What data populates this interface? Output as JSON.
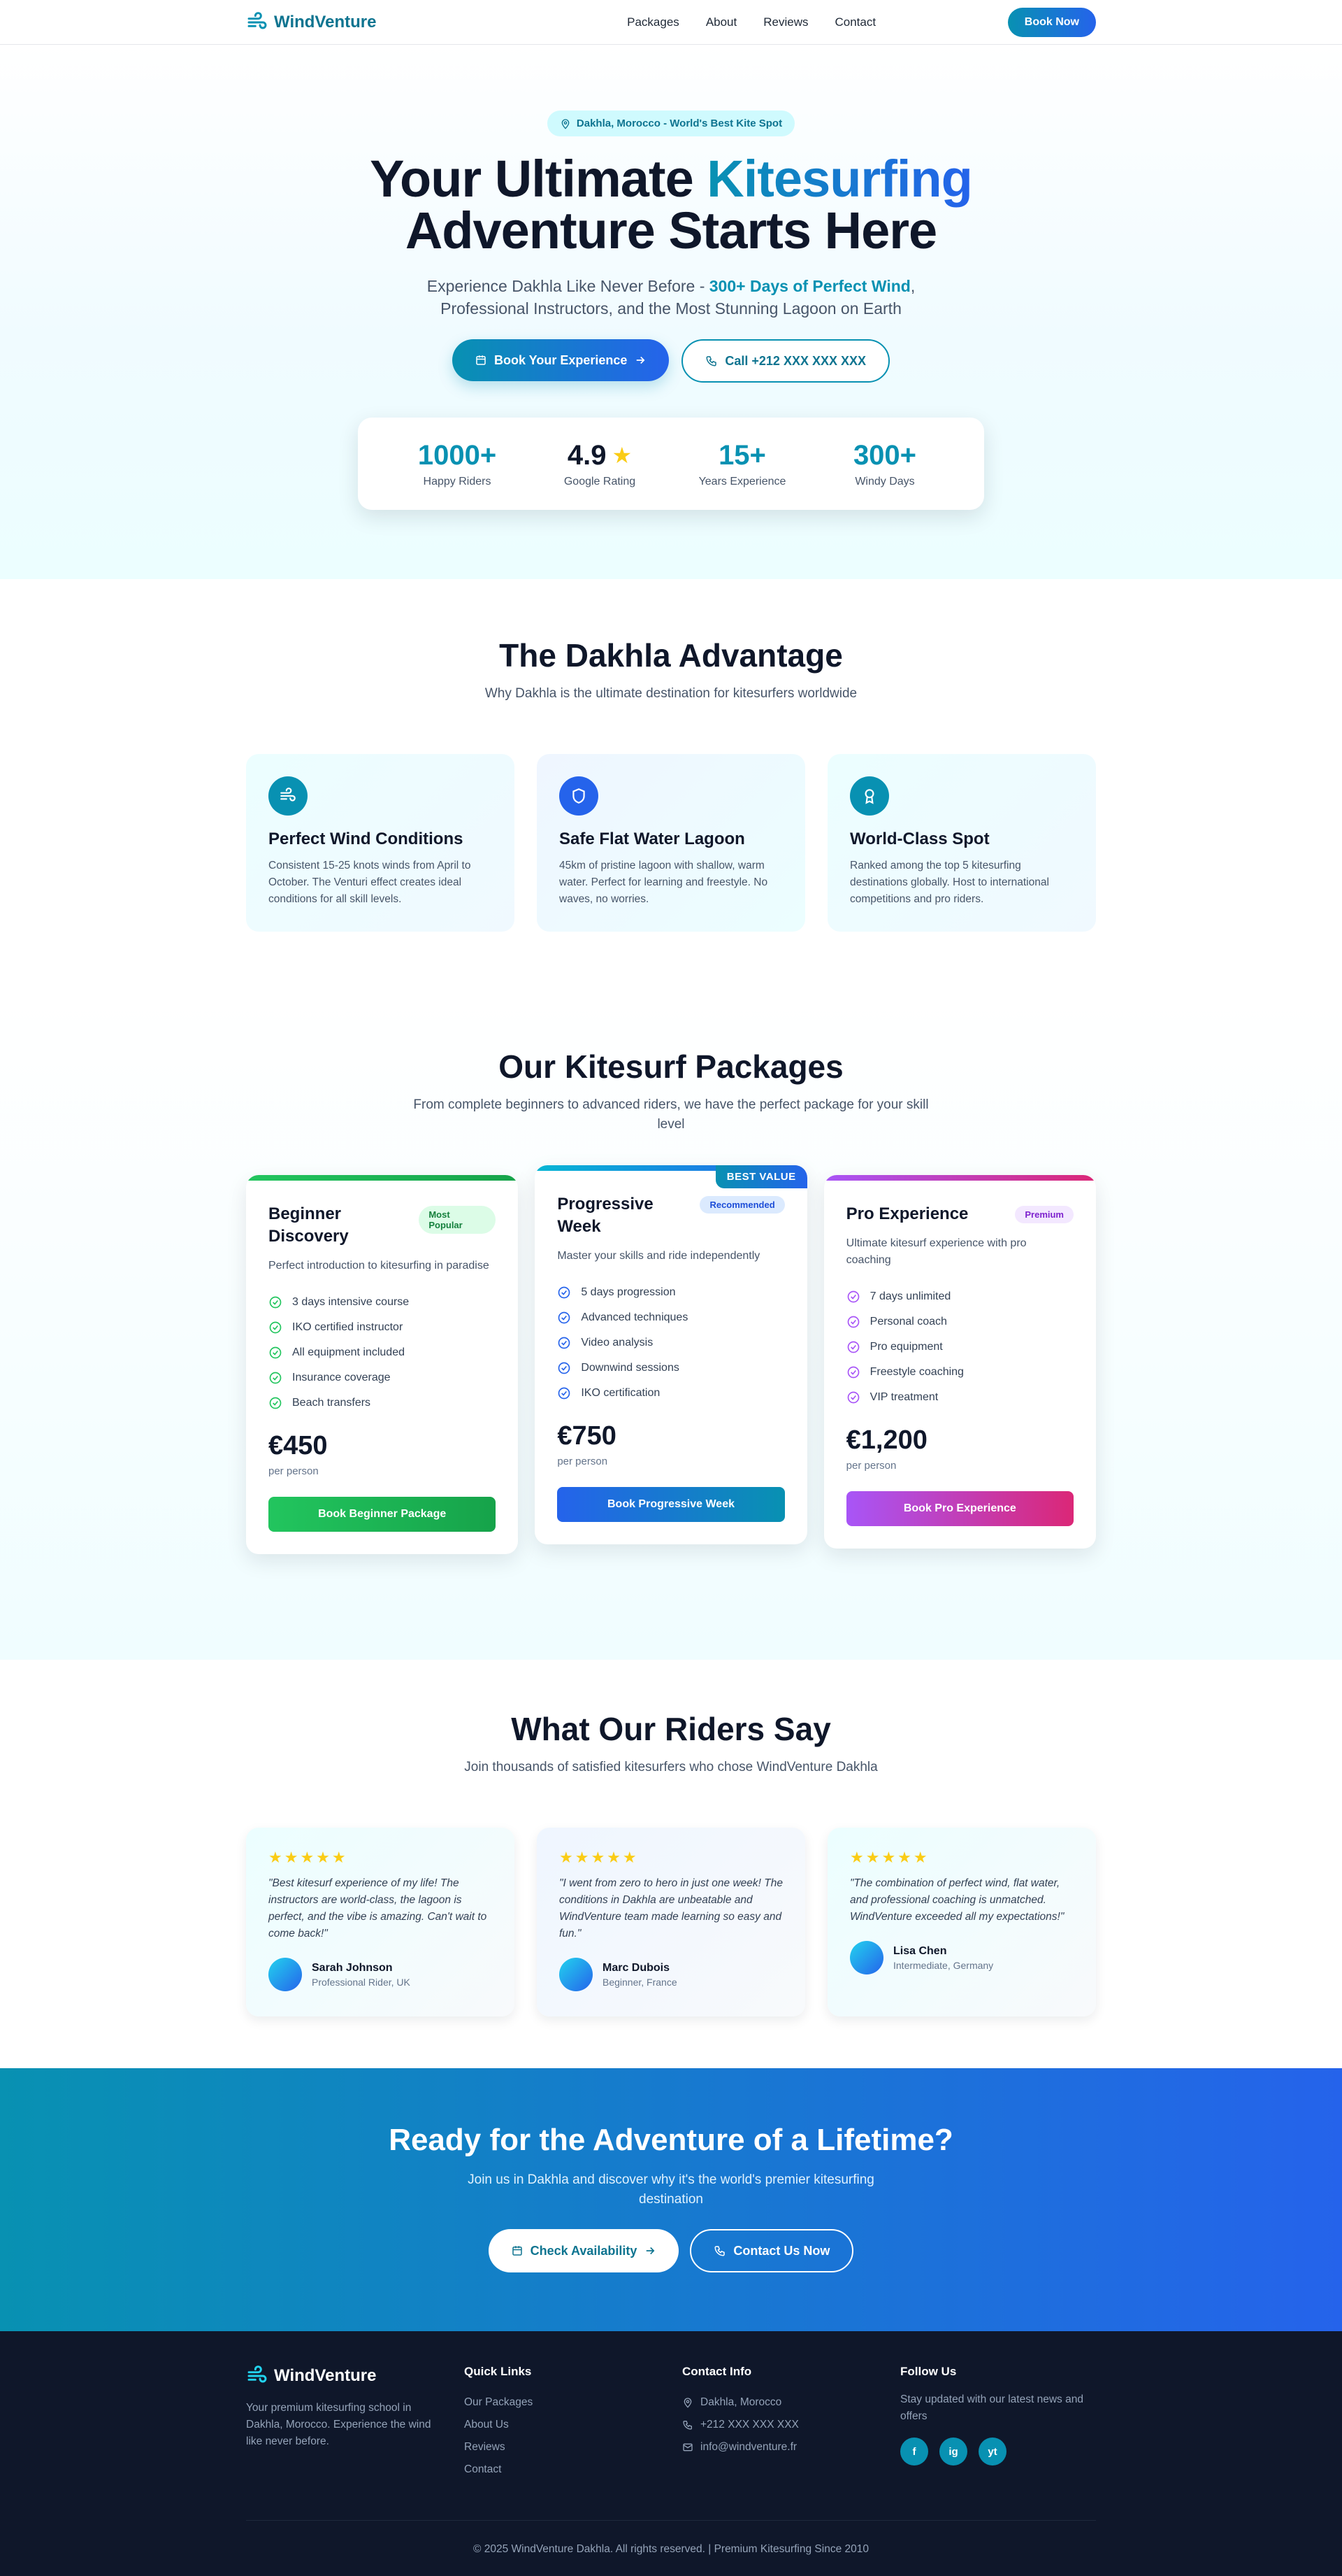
{
  "header": {
    "brand": "WindVenture",
    "nav": [
      "Packages",
      "About",
      "Reviews",
      "Contact"
    ],
    "book_label": "Book Now"
  },
  "hero": {
    "location_pill": "Dakhla, Morocco - World's Best Kite Spot",
    "title_part1": "Your Ultimate ",
    "title_accent": "Kitesurfing",
    "title_part2": "Adventure Starts Here",
    "sub_part1": "Experience Dakhla Like Never Before - ",
    "sub_highlight": "300+ Days of Perfect Wind",
    "sub_part2": ",",
    "sub_line2": "Professional Instructors, and the Most Stunning Lagoon on Earth",
    "cta_primary": "Book Your Experience",
    "cta_secondary": "Call +212 XXX XXX XXX",
    "stats": [
      {
        "value": "1000+",
        "label": "Happy Riders"
      },
      {
        "value": "4.9",
        "label": "Google Rating"
      },
      {
        "value": "15+",
        "label": "Years Experience"
      },
      {
        "value": "300+",
        "label": "Windy Days"
      }
    ]
  },
  "advantage": {
    "title": "The Dakhla Advantage",
    "subtitle": "Why Dakhla is the ultimate destination for kitesurfers worldwide",
    "cards": [
      {
        "icon": "wind-icon",
        "title": "Perfect Wind Conditions",
        "text": "Consistent 15-25 knots winds from April to October. The Venturi effect creates ideal conditions for all skill levels."
      },
      {
        "icon": "shield-icon",
        "title": "Safe Flat Water Lagoon",
        "text": "45km of pristine lagoon with shallow, warm water. Perfect for learning and freestyle. No waves, no worries."
      },
      {
        "icon": "award-icon",
        "title": "World-Class Spot",
        "text": "Ranked among the top 5 kitesurfing destinations globally. Host to international competitions and pro riders."
      }
    ]
  },
  "packages": {
    "title": "Our Kitesurf Packages",
    "subtitle": "From complete beginners to advanced riders, we have the perfect package for your skill level",
    "items": [
      {
        "name": "Beginner Discovery",
        "badge": "Most Popular",
        "desc": "Perfect introduction to kitesurfing in paradise",
        "features": [
          "3 days intensive course",
          "IKO certified instructor",
          "All equipment included",
          "Insurance coverage",
          "Beach transfers"
        ],
        "price": "€450",
        "per": "per person",
        "button": "Book Beginner Package",
        "accent": "#22c55e"
      },
      {
        "name": "Progressive Week",
        "badge": "Recommended",
        "ribbon": "BEST VALUE",
        "desc": "Master your skills and ride independently",
        "features": [
          "5 days progression",
          "Advanced techniques",
          "Video analysis",
          "Downwind sessions",
          "IKO certification"
        ],
        "price": "€750",
        "per": "per person",
        "button": "Book Progressive Week",
        "accent": "#2563eb"
      },
      {
        "name": "Pro Experience",
        "badge": "Premium",
        "desc": "Ultimate kitesurf experience with pro coaching",
        "features": [
          "7 days unlimited",
          "Personal coach",
          "Pro equipment",
          "Freestyle coaching",
          "VIP treatment"
        ],
        "price": "€1,200",
        "per": "per person",
        "button": "Book Pro Experience",
        "accent": "#a855f7"
      }
    ]
  },
  "testimonials": {
    "title": "What Our Riders Say",
    "subtitle": "Join thousands of satisfied kitesurfers who chose WindVenture Dakhla",
    "items": [
      {
        "stars": "★★★★★",
        "quote": "\"Best kitesurf experience of my life! The instructors are world-class, the lagoon is perfect, and the vibe is amazing. Can't wait to come back!\"",
        "name": "Sarah Johnson",
        "role": "Professional Rider, UK"
      },
      {
        "stars": "★★★★★",
        "quote": "\"I went from zero to hero in just one week! The conditions in Dakhla are unbeatable and WindVenture team made learning so easy and fun.\"",
        "name": "Marc Dubois",
        "role": "Beginner, France"
      },
      {
        "stars": "★★★★★",
        "quote": "\"The combination of perfect wind, flat water, and professional coaching is unmatched. WindVenture exceeded all my expectations!\"",
        "name": "Lisa Chen",
        "role": "Intermediate, Germany"
      }
    ]
  },
  "cta": {
    "title": "Ready for the Adventure of a Lifetime?",
    "subtitle": "Join us in Dakhla and discover why it's the world's premier kitesurfing destination",
    "primary": "Check Availability",
    "secondary": "Contact Us Now"
  },
  "footer": {
    "brand": "WindVenture",
    "about": "Your premium kitesurfing school in Dakhla, Morocco. Experience the wind like never before.",
    "links_title": "Quick Links",
    "links": [
      "Our Packages",
      "About Us",
      "Reviews",
      "Contact"
    ],
    "contact_title": "Contact Info",
    "contact": {
      "location": "Dakhla, Morocco",
      "phone": "+212 XXX XXX XXX",
      "email": "info@windventure.fr"
    },
    "follow_title": "Follow Us",
    "follow_text": "Stay updated with our latest news and offers",
    "socials": [
      "f",
      "ig",
      "yt"
    ],
    "copyright": "© 2025 WindVenture Dakhla. All rights reserved. | Premium Kitesurfing Since 2010"
  },
  "colors": {
    "primary": "#0891b2",
    "secondary": "#2563eb",
    "dark": "#0f172a",
    "star": "#facc15"
  }
}
